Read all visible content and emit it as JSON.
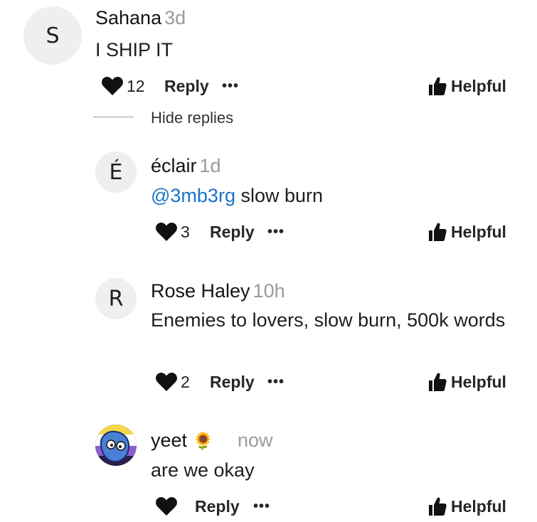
{
  "comment": {
    "avatar_letter": "S",
    "author": "Sahana",
    "time": "3d",
    "text": "I SHIP IT",
    "likes": "12",
    "reply_label": "Reply",
    "more_label": "•••",
    "helpful_label": "Helpful",
    "hide_replies_label": "Hide replies"
  },
  "replies": [
    {
      "avatar_letter": "É",
      "author": "éclair",
      "time": "1d",
      "mention": "@3mb3rg",
      "text": " slow burn",
      "likes": "3",
      "reply_label": "Reply",
      "more_label": "•••",
      "helpful_label": "Helpful"
    },
    {
      "avatar_letter": "R",
      "author": "Rose Haley",
      "time": "10h",
      "text": "Enemies to lovers, slow burn, 500k words",
      "likes": "2",
      "reply_label": "Reply",
      "more_label": "•••",
      "helpful_label": "Helpful"
    },
    {
      "author": "yeet",
      "author_emoji": "🌻",
      "time": "now",
      "text": "are we okay",
      "reply_label": "Reply",
      "more_label": "•••",
      "helpful_label": "Helpful"
    }
  ],
  "colors": {
    "mention": "#1a73c9",
    "muted": "#9a9a9a"
  }
}
